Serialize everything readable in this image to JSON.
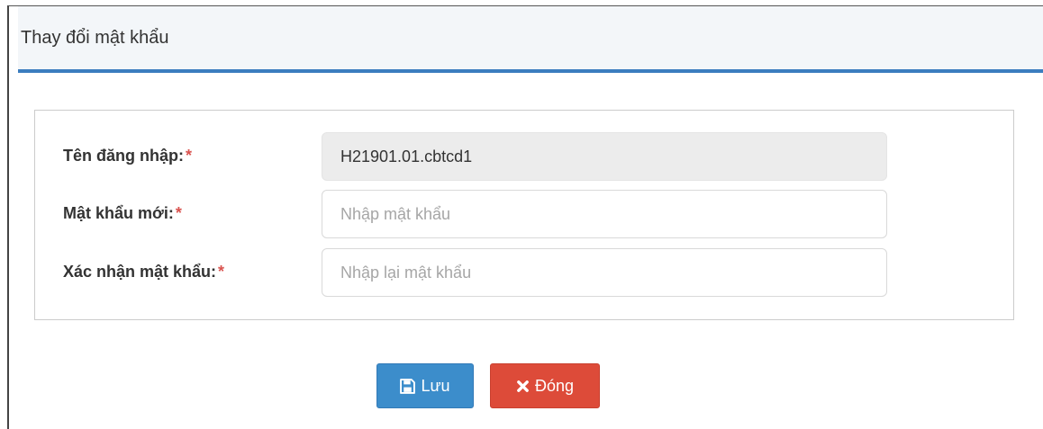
{
  "modal": {
    "title": "Thay đổi mật khẩu"
  },
  "form": {
    "username": {
      "label": "Tên đăng nhập:",
      "required_mark": "*",
      "value": "H21901.01.cbtcd1"
    },
    "new_password": {
      "label": "Mật khẩu mới:",
      "required_mark": "*",
      "value": "",
      "placeholder": "Nhập mật khẩu"
    },
    "confirm_password": {
      "label": "Xác nhận mật khẩu:",
      "required_mark": "*",
      "value": "",
      "placeholder": "Nhập lại mật khẩu"
    }
  },
  "buttons": {
    "save": {
      "label": "Lưu",
      "icon": "floppy-disk-icon",
      "color": "#3c8dcb"
    },
    "close": {
      "label": "Đóng",
      "icon": "close-icon",
      "color": "#dd4b39"
    }
  },
  "colors": {
    "header_accent": "#3b7dbf",
    "required": "#d9534f"
  }
}
